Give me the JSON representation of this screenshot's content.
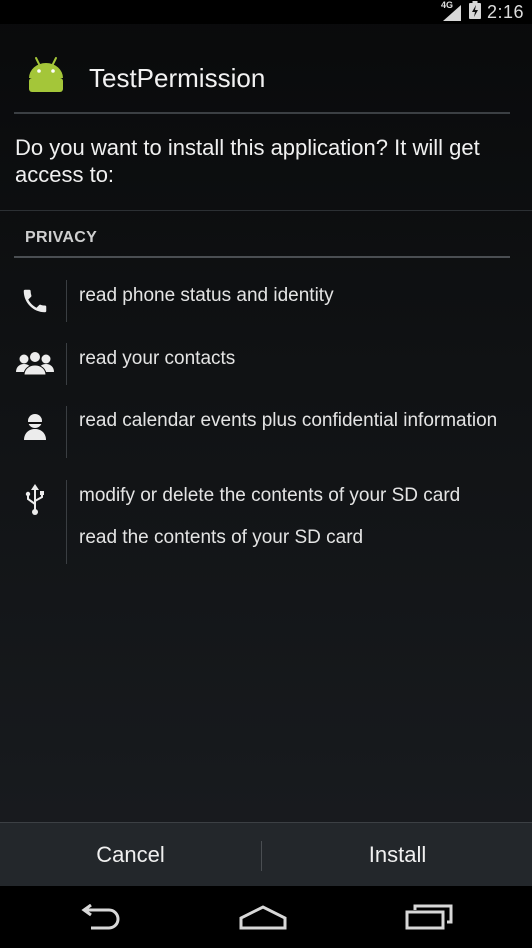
{
  "status_bar": {
    "network_type": "4G",
    "time": "2:16",
    "icons": [
      "signal-icon",
      "battery-charging-icon"
    ]
  },
  "header": {
    "app_name": "TestPermission",
    "app_icon": "android-icon"
  },
  "prompt": "Do you want to install this application? It will get access to:",
  "section": {
    "label": "PRIVACY",
    "groups": [
      {
        "icon": "phone-icon",
        "items": [
          "read phone status and identity"
        ]
      },
      {
        "icon": "contacts-icon",
        "items": [
          "read your contacts"
        ]
      },
      {
        "icon": "person-icon",
        "items": [
          "read calendar events plus confidential information"
        ]
      },
      {
        "icon": "usb-icon",
        "items": [
          "modify or delete the contents of your SD card",
          "read the contents of your SD card"
        ]
      }
    ]
  },
  "buttons": {
    "cancel": "Cancel",
    "install": "Install"
  },
  "nav_bar": {
    "icons": [
      "back-icon",
      "home-icon",
      "recent-apps-icon"
    ]
  },
  "colors": {
    "android_green": "#a4c639",
    "background": "#101214",
    "text": "#e6e6e6"
  }
}
